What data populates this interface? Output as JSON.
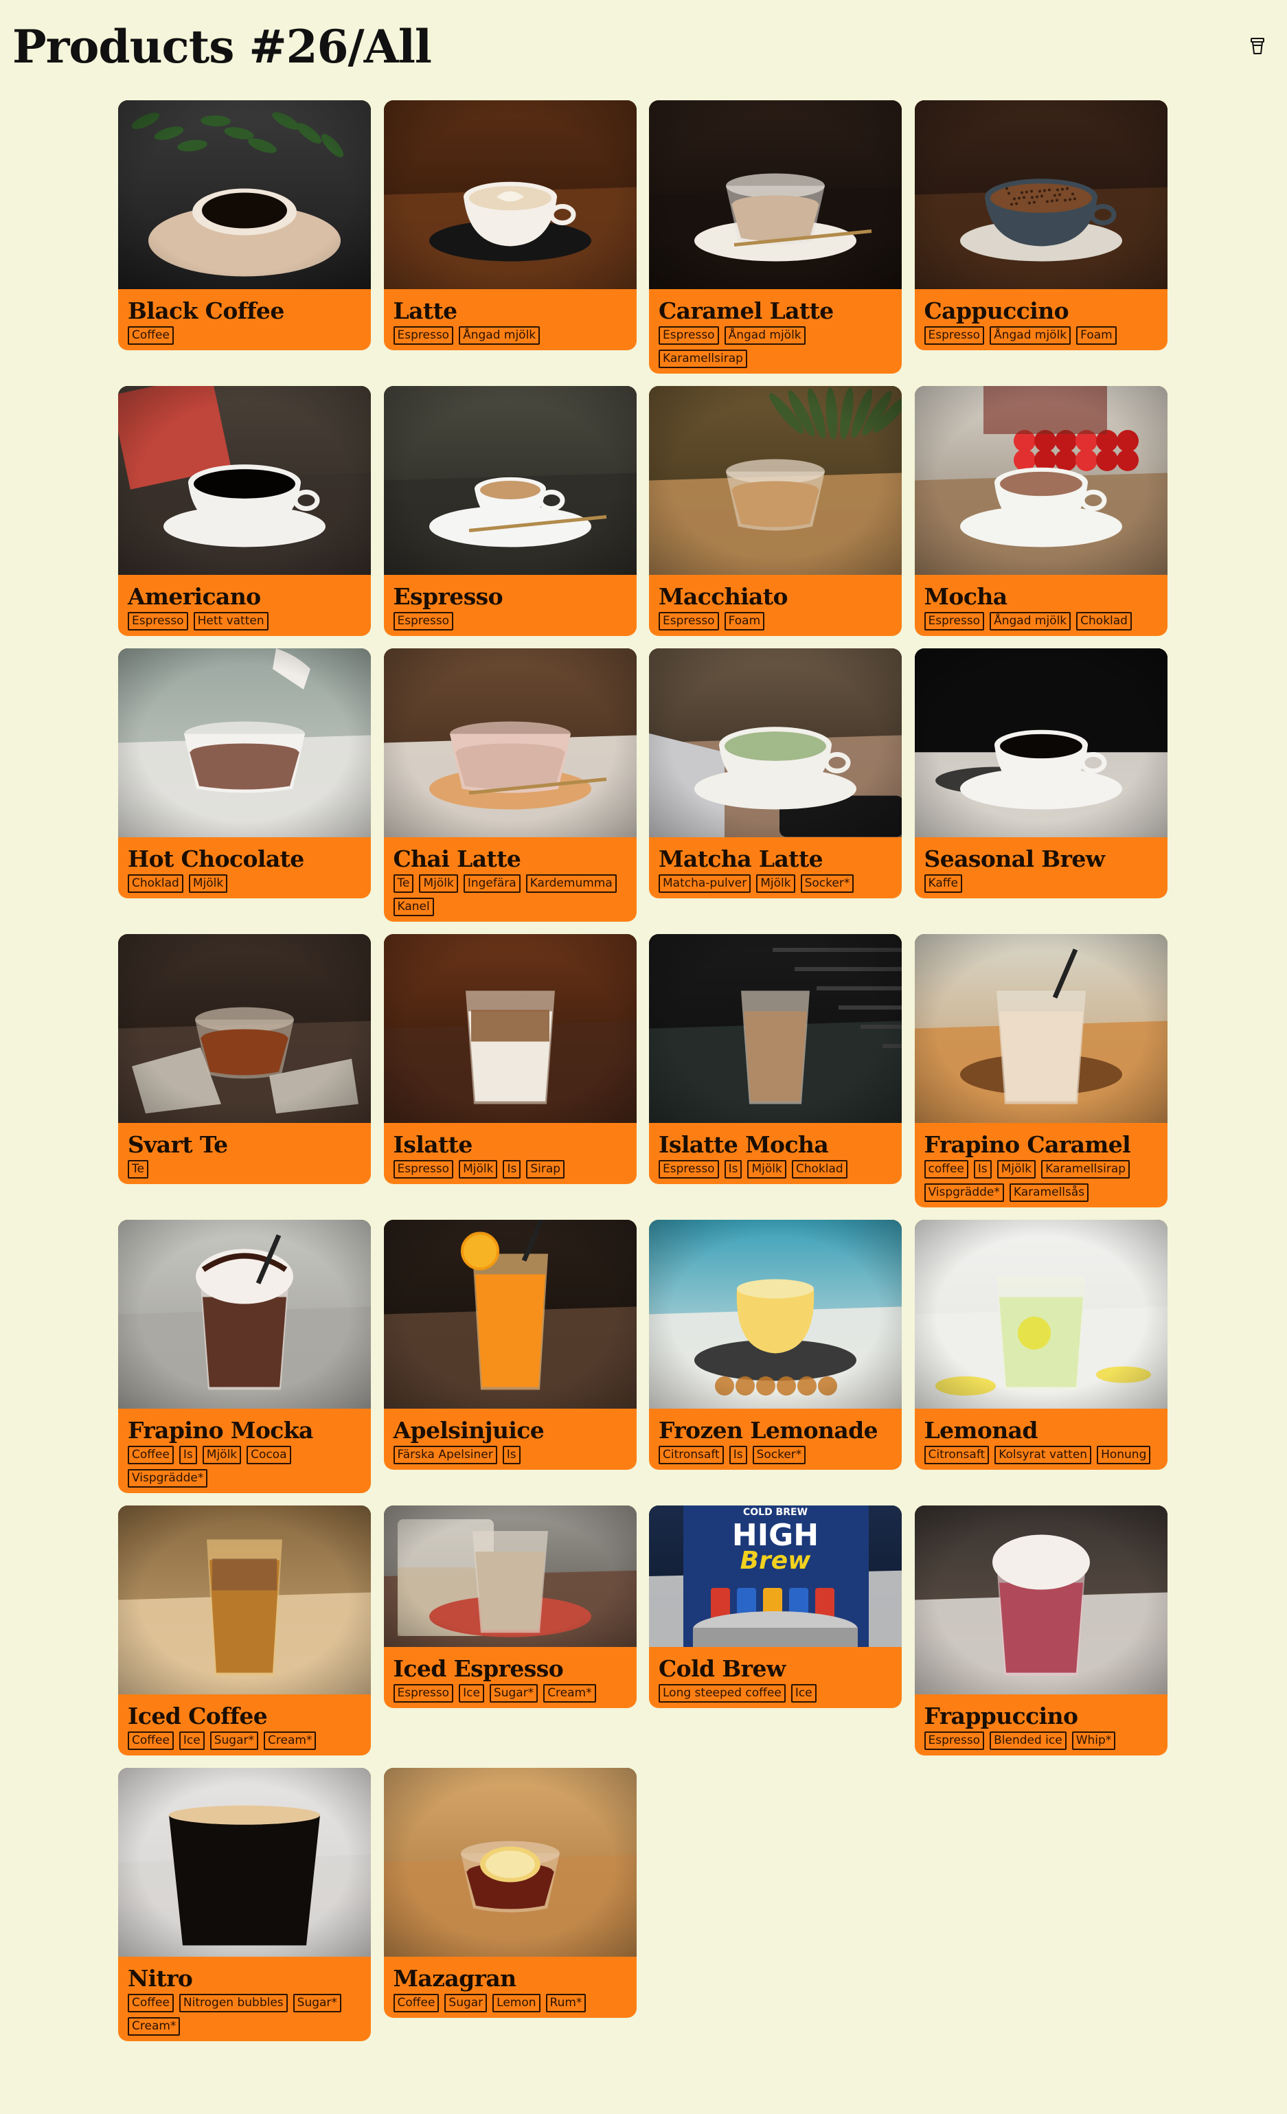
{
  "header": {
    "title": "Products #26/All",
    "cart_icon": "cup-icon"
  },
  "products": [
    {
      "name": "Black Coffee",
      "tags": [
        "Coffee"
      ],
      "image": "black-coffee-photo"
    },
    {
      "name": "Latte",
      "tags": [
        "Espresso",
        "Ångad mjölk"
      ],
      "image": "latte-photo"
    },
    {
      "name": "Caramel Latte",
      "tags": [
        "Espresso",
        "Ångad mjölk",
        "Karamellsirap"
      ],
      "image": "caramel-latte-photo"
    },
    {
      "name": "Cappuccino",
      "tags": [
        "Espresso",
        "Ångad mjölk",
        "Foam"
      ],
      "image": "cappuccino-photo"
    },
    {
      "name": "Americano",
      "tags": [
        "Espresso",
        "Hett vatten"
      ],
      "image": "americano-photo"
    },
    {
      "name": "Espresso",
      "tags": [
        "Espresso"
      ],
      "image": "espresso-photo"
    },
    {
      "name": "Macchiato",
      "tags": [
        "Espresso",
        "Foam"
      ],
      "image": "macchiato-photo"
    },
    {
      "name": "Mocha",
      "tags": [
        "Espresso",
        "Ångad mjölk",
        "Choklad"
      ],
      "image": "mocha-photo"
    },
    {
      "name": "Hot Chocolate",
      "tags": [
        "Choklad",
        "Mjölk"
      ],
      "image": "hot-chocolate-photo"
    },
    {
      "name": "Chai Latte",
      "tags": [
        "Te",
        "Mjölk",
        "Ingefära",
        "Kardemumma",
        "Kanel"
      ],
      "image": "chai-latte-photo"
    },
    {
      "name": "Matcha Latte",
      "tags": [
        "Matcha-pulver",
        "Mjölk",
        "Socker*"
      ],
      "image": "matcha-latte-photo"
    },
    {
      "name": "Seasonal Brew",
      "tags": [
        "Kaffe"
      ],
      "image": "seasonal-brew-photo"
    },
    {
      "name": "Svart Te",
      "tags": [
        "Te"
      ],
      "image": "svart-te-photo"
    },
    {
      "name": "Islatte",
      "tags": [
        "Espresso",
        "Mjölk",
        "Is",
        "Sirap"
      ],
      "image": "islatte-photo"
    },
    {
      "name": "Islatte Mocha",
      "tags": [
        "Espresso",
        "Is",
        "Mjölk",
        "Choklad"
      ],
      "image": "islatte-mocha-photo"
    },
    {
      "name": "Frapino Caramel",
      "tags": [
        "coffee",
        "Is",
        "Mjölk",
        "Karamellsirap",
        "Vispgrädde*",
        "Karamellsås"
      ],
      "image": "frapino-caramel-photo"
    },
    {
      "name": "Frapino Mocka",
      "tags": [
        "Coffee",
        "Is",
        "Mjölk",
        "Cocoa",
        "Vispgrädde*"
      ],
      "image": "frapino-mocka-photo"
    },
    {
      "name": "Apelsinjuice",
      "tags": [
        "Färska Apelsiner",
        "Is"
      ],
      "image": "apelsinjuice-photo"
    },
    {
      "name": "Frozen Lemonade",
      "tags": [
        "Citronsaft",
        "Is",
        "Socker*"
      ],
      "image": "frozen-lemonade-photo"
    },
    {
      "name": "Lemonad",
      "tags": [
        "Citronsaft",
        "Kolsyrat vatten",
        "Honung"
      ],
      "image": "lemonad-photo"
    },
    {
      "name": "Iced Coffee",
      "tags": [
        "Coffee",
        "Ice",
        "Sugar*",
        "Cream*"
      ],
      "image": "iced-coffee-photo"
    },
    {
      "name": "Iced Espresso",
      "tags": [
        "Espresso",
        "Ice",
        "Sugar*",
        "Cream*"
      ],
      "image": "iced-espresso-photo"
    },
    {
      "name": "Cold Brew",
      "tags": [
        "Long steeped coffee",
        "Ice"
      ],
      "image": "cold-brew-photo",
      "image_text": [
        "COLD BREW",
        "HIGH",
        "Brew"
      ]
    },
    {
      "name": "Frappuccino",
      "tags": [
        "Espresso",
        "Blended ice",
        "Whip*"
      ],
      "image": "frappuccino-photo"
    },
    {
      "name": "Nitro",
      "tags": [
        "Coffee",
        "Nitrogen bubbles",
        "Sugar*",
        "Cream*"
      ],
      "image": "nitro-photo"
    },
    {
      "name": "Mazagran",
      "tags": [
        "Coffee",
        "Sugar",
        "Lemon",
        "Rum*"
      ],
      "image": "mazagran-photo"
    }
  ]
}
